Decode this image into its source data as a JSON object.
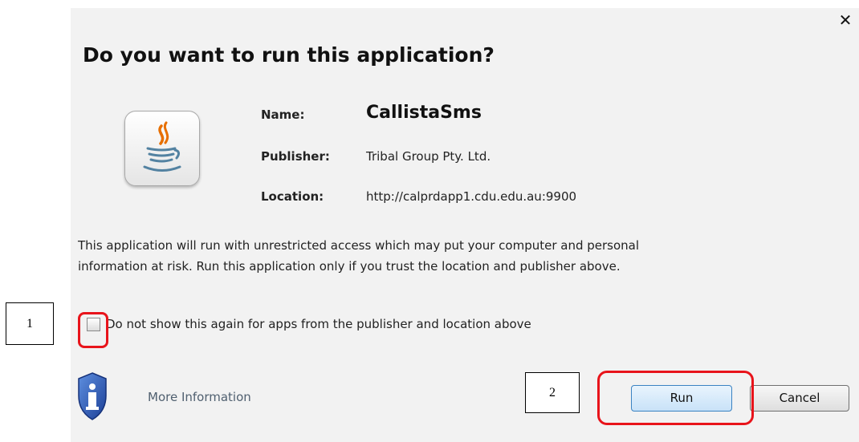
{
  "dialog": {
    "title": "Do you want to run this application?",
    "close_icon": "close-icon",
    "app_icon": "java-icon",
    "fields": {
      "name_label": "Name:",
      "name_value": "CallistaSms",
      "publisher_label": "Publisher:",
      "publisher_value": "Tribal Group Pty. Ltd.",
      "location_label": "Location:",
      "location_value": "http://calprdapp1.cdu.edu.au:9900"
    },
    "warning_line1": "This application will run with unrestricted access which may put your computer and personal",
    "warning_line2": "information at risk. Run this application only if you trust the location and publisher above.",
    "checkbox": {
      "label": "Do not show this again for apps from the publisher and location above",
      "checked": false
    },
    "more_info_icon": "info-shield-icon",
    "more_info_label": "More Information",
    "run_label": "Run",
    "cancel_label": "Cancel"
  },
  "annotations": {
    "callout_1": "1",
    "callout_2": "2",
    "highlight_color": "#e8141b"
  },
  "colors": {
    "dialog_bg": "#f2f2f2",
    "link_text": "#506070",
    "run_button_border": "#3b83c2"
  }
}
